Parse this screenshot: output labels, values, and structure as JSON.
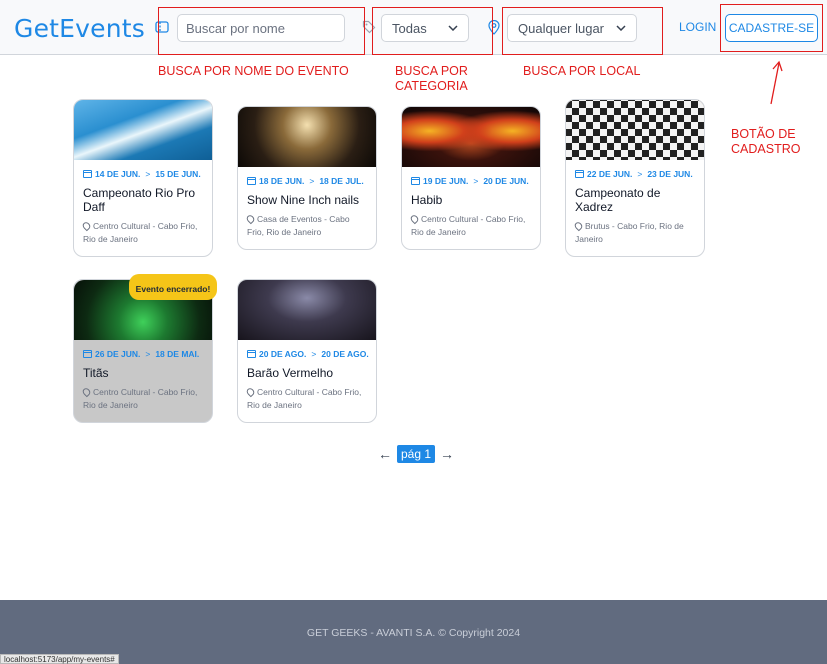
{
  "header": {
    "logo": "GetEvents",
    "search_placeholder": "Buscar por nome",
    "category": "Todas",
    "location": "Qualquer lugar",
    "login": "LOGIN",
    "signup": "CADASTRE-SE"
  },
  "annotations": {
    "name": "BUSCA POR NOME DO EVENTO",
    "category": "BUSCA POR CATEGORIA",
    "location": "BUSCA POR LOCAL",
    "signup": "BOTÃO DE CADASTRO"
  },
  "events": [
    {
      "start": "14 DE JUN.",
      "end": "15 DE JUN.",
      "title": "Campeonato Rio Pro Daff",
      "location": "Centro Cultural - Cabo Frio, Rio de Janeiro"
    },
    {
      "start": "18 DE JUN.",
      "end": "18 DE JUL.",
      "title": "Show Nine Inch nails",
      "location": "Casa de Eventos - Cabo Frio, Rio de Janeiro"
    },
    {
      "start": "19 DE JUN.",
      "end": "20 DE JUN.",
      "title": "Habib",
      "location": "Centro Cultural - Cabo Frio, Rio de Janeiro"
    },
    {
      "start": "22 DE JUN.",
      "end": "23 DE JUN.",
      "title": "Campeonato de Xadrez",
      "location": "Brutus - Cabo Frio, Rio de Janeiro"
    },
    {
      "start": "26 DE JUN.",
      "end": "18 DE MAI.",
      "title": "Titãs",
      "location": "Centro Cultural - Cabo Frio, Rio de Janeiro",
      "badge": "Evento encerrado!"
    },
    {
      "start": "20 DE AGO.",
      "end": "20 DE AGO.",
      "title": "Barão Vermelho",
      "location": "Centro Cultural - Cabo Frio, Rio de Janeiro"
    }
  ],
  "pagination": {
    "prev": "←",
    "page": "pág 1",
    "next": "→"
  },
  "footer": "GET GEEKS - AVANTI S.A. © Copyright 2024",
  "status_url": "localhost:5173/app/my-events#",
  "colors": {
    "accent": "#1e88e5",
    "annotation": "#e11d1d",
    "footer": "#616b7f",
    "badge": "#f5c518"
  }
}
